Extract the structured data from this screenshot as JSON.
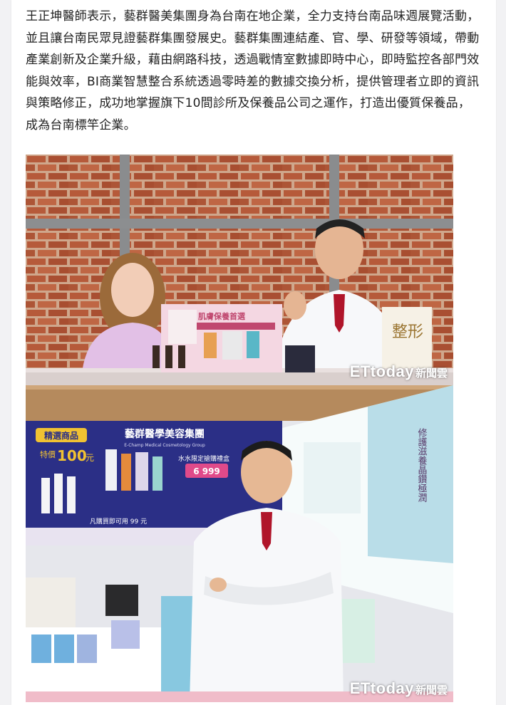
{
  "article": {
    "paragraph": "王正坤醫師表示，藝群醫美集團身為台南在地企業，全力支持台南品味週展覽活動，並且讓台南民眾見證藝群集團發展史。藝群集團連結產、官、學、研發等領域，帶動產業創新及企業升級，藉由網路科技，透過戰情室數據即時中心，即時監控各部門效能與效率，BI商業智慧整合系統透過零時差的數據交換分析，提供管理者立即的資訊與策略修正，成功地掌握旗下10間診所及保養品公司之運作，打造出優質保養品，成為台南標竿企業。"
  },
  "photo1": {
    "watermark_brand": "ETtoday",
    "watermark_sub": "新聞雲",
    "display_title": "肌膚保養首選",
    "box_text": "整形"
  },
  "photo2": {
    "watermark_brand": "ETtoday",
    "watermark_sub": "新聞雲",
    "banner_group": "藝群醫學美容集團",
    "banner_group_en": "E-Champ Medical Cosmetology Group",
    "badge_select": "精選商品",
    "price_label": "特價",
    "price_value": "100",
    "price_unit": "元",
    "promo_line": "水水限定搶購禮盒",
    "promo_price": "6 999",
    "bottom_promo": "凡購買即可用 99 元",
    "poster_vertical": "修護滋養晶鑽極潤"
  },
  "colors": {
    "brick": "#b65a3a",
    "mortar": "#d8b9a3",
    "banner_blue": "#2b2f86",
    "gold": "#f1c232",
    "coat": "#f7f8fa",
    "tie": "#b0152a"
  }
}
